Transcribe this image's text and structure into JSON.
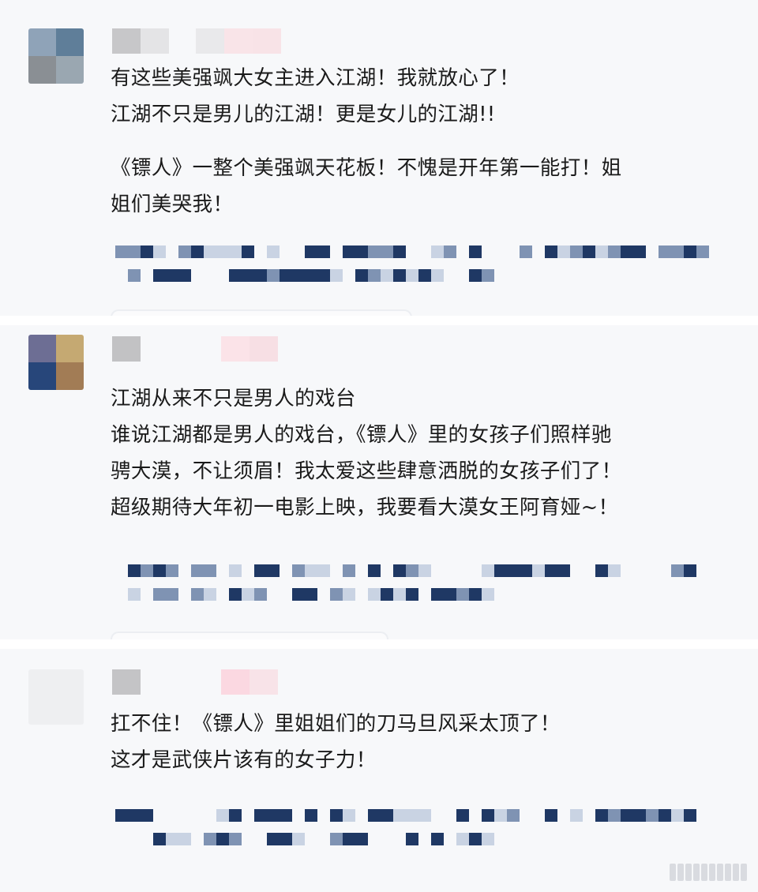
{
  "comments": [
    {
      "lines": [
        "有这些美强飒大女主进入江湖！我就放心了！",
        "江湖不只是男儿的江湖！更是女儿的江湖!!"
      ],
      "paragraph2": [
        "《镖人》一整个美强飒天花板！不愧是开年第一能打！姐",
        "姐们美哭我！"
      ]
    },
    {
      "lines": [
        "江湖从来不只是男人的戏台",
        "谁说江湖都是男人的戏台，《镖人》里的女孩子们照样驰",
        "骋大漠，不让须眉！我太爱这些肆意洒脱的女孩子们了！",
        "超级期待大年初一电影上映，我要看大漠女王阿育娅~！"
      ]
    },
    {
      "lines": [
        "扛不住！《镖人》里姐姐们的刀马旦风采太顶了！",
        "这才是武侠片该有的女子力！"
      ]
    }
  ],
  "colors": {
    "card_background": "#f7f8fa",
    "text": "#1a1a1a",
    "mosaic_dark": "#1f3864",
    "mosaic_mid": "#7f93b3",
    "mosaic_light": "#c9d3e3"
  }
}
